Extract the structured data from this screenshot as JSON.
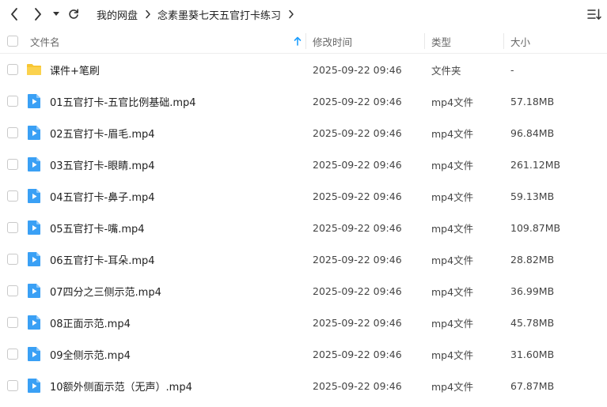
{
  "colors": {
    "accent": "#1e9fff",
    "folder": "#f8c633",
    "video_icon": "#3aa0f5",
    "header_text": "#666666",
    "border": "#eeeeee"
  },
  "toolbar": {
    "back_icon": "chevron-left-icon",
    "forward_icon": "chevron-right-icon",
    "history_icon": "caret-down-icon",
    "refresh_icon": "refresh-icon",
    "sort_menu_icon": "sort-list-icon"
  },
  "breadcrumb": {
    "items": [
      "我的网盘",
      "念素墨葵七天五官打卡练习"
    ]
  },
  "columns": {
    "name": "文件名",
    "modified": "修改时间",
    "type": "类型",
    "size": "大小"
  },
  "files": [
    {
      "name": "课件+笔刷",
      "modified": "2025-09-22 09:46",
      "type": "文件夹",
      "size": "-",
      "icon": "folder-icon"
    },
    {
      "name": "01五官打卡-五官比例基础.mp4",
      "modified": "2025-09-22 09:46",
      "type": "mp4文件",
      "size": "57.18MB",
      "icon": "video-file-icon"
    },
    {
      "name": "02五官打卡-眉毛.mp4",
      "modified": "2025-09-22 09:46",
      "type": "mp4文件",
      "size": "96.84MB",
      "icon": "video-file-icon"
    },
    {
      "name": "03五官打卡-眼睛.mp4",
      "modified": "2025-09-22 09:46",
      "type": "mp4文件",
      "size": "261.12MB",
      "icon": "video-file-icon"
    },
    {
      "name": "04五官打卡-鼻子.mp4",
      "modified": "2025-09-22 09:46",
      "type": "mp4文件",
      "size": "59.13MB",
      "icon": "video-file-icon"
    },
    {
      "name": "05五官打卡-嘴.mp4",
      "modified": "2025-09-22 09:46",
      "type": "mp4文件",
      "size": "109.87MB",
      "icon": "video-file-icon"
    },
    {
      "name": "06五官打卡-耳朵.mp4",
      "modified": "2025-09-22 09:46",
      "type": "mp4文件",
      "size": "28.82MB",
      "icon": "video-file-icon"
    },
    {
      "name": "07四分之三侧示范.mp4",
      "modified": "2025-09-22 09:46",
      "type": "mp4文件",
      "size": "36.99MB",
      "icon": "video-file-icon"
    },
    {
      "name": "08正面示范.mp4",
      "modified": "2025-09-22 09:46",
      "type": "mp4文件",
      "size": "45.78MB",
      "icon": "video-file-icon"
    },
    {
      "name": "09全侧示范.mp4",
      "modified": "2025-09-22 09:46",
      "type": "mp4文件",
      "size": "31.60MB",
      "icon": "video-file-icon"
    },
    {
      "name": "10额外侧面示范（无声）.mp4",
      "modified": "2025-09-22 09:46",
      "type": "mp4文件",
      "size": "67.87MB",
      "icon": "video-file-icon"
    }
  ]
}
